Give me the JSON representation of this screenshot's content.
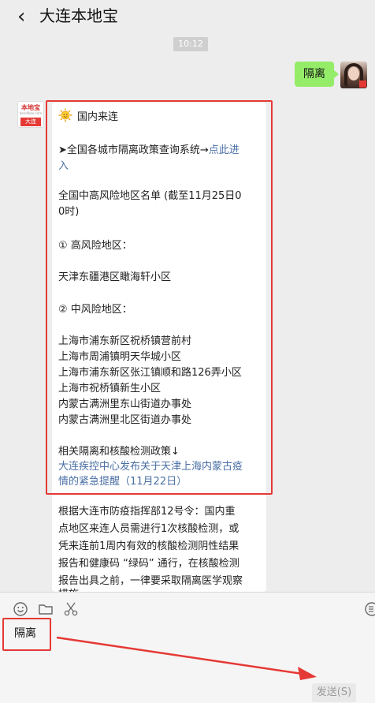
{
  "header": {
    "back_glyph": "‹",
    "title": "大连本地宝"
  },
  "time": "10:12",
  "my_message": {
    "text": "隔离"
  },
  "biz_avatar": {
    "brand": "本地宝",
    "sub": "bendibao.com",
    "city": "大连"
  },
  "card": {
    "title": "国内来连",
    "policy_prefix": "➤全国各城市隔离政策查询系统→",
    "policy_link_1": "点此进",
    "policy_link_2": "入",
    "list_title_1": "全国中高风险地区名单 (截至11月25日0",
    "list_title_2": "0时)",
    "high_risk_heading": "① 高风险地区：",
    "high_risk_areas": [
      "天津东疆港区瞰海轩小区"
    ],
    "mid_risk_heading": "② 中风险地区：",
    "mid_risk_areas": [
      "上海市浦东新区祝桥镇营前村",
      "上海市周浦镇明天华城小区",
      "上海市浦东新区张江镇顺和路126弄小区",
      "上海市祝桥镇新生小区",
      "内蒙古满洲里东山街道办事处",
      "内蒙古满洲里北区街道办事处"
    ],
    "related_heading": "相关隔离和核酸检测政策↓",
    "related_link_1": "大连疾控中心发布关于天津上海内蒙古疫",
    "related_link_2": "情的紧急提醒（11月22日）",
    "notice_lines": [
      "根据大连市防疫指挥部12号令：国内重",
      "点地区来连人员需进行1次核酸检测，或",
      "凭来连前1周内有效的核酸检测阴性结果",
      "报告和健康码 “绿码” 通行，在核酸检测",
      "报告出具之前，一律要采取隔离医学观察",
      "措施"
    ]
  },
  "input": {
    "typed_text": "隔离"
  },
  "send_label": "发送(S)",
  "colors": {
    "highlight": "#e53935",
    "link": "#4a6fa5",
    "my_bubble": "#95ec69"
  },
  "icons": [
    "back-arrow-icon",
    "sun-icon",
    "emoji-icon",
    "folder-icon",
    "scissors-icon"
  ]
}
